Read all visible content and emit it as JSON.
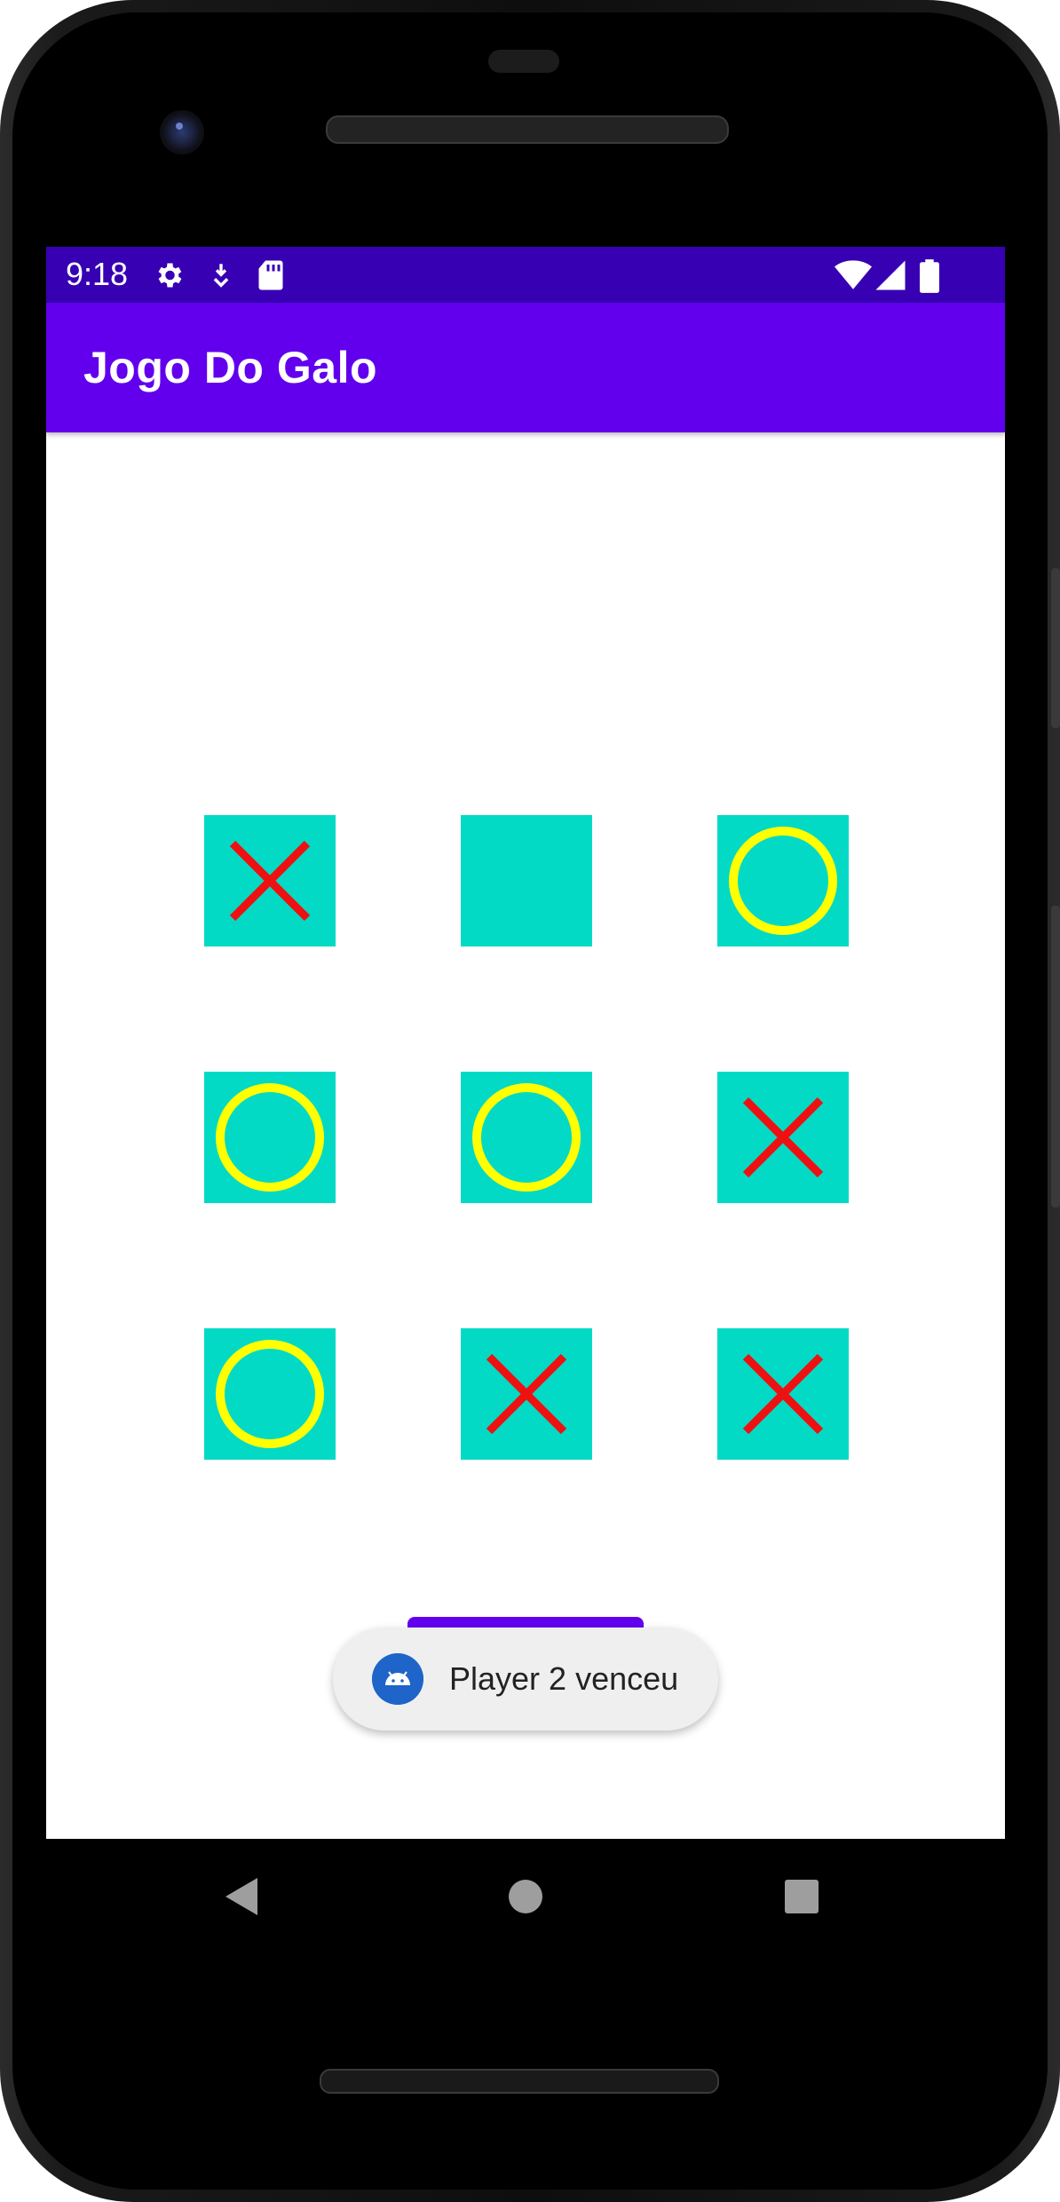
{
  "status_bar": {
    "time": "9:18",
    "left_icons": [
      "gear-icon",
      "download-icon",
      "sd-card-icon"
    ],
    "right_icons": [
      "wifi-icon",
      "signal-icon",
      "battery-icon"
    ],
    "background": "#3700b3"
  },
  "app_bar": {
    "title": "Jogo Do Galo",
    "background": "#6200ee"
  },
  "board": {
    "cell_color": "#03dac5",
    "x_color": "#ee1111",
    "o_color": "#ffff00",
    "cells": [
      "X",
      "",
      "O",
      "O",
      "O",
      "X",
      "O",
      "X",
      "X"
    ]
  },
  "toast": {
    "message": "Player 2 venceu",
    "icon": "android-icon"
  },
  "nav_bar": {
    "buttons": [
      "back-icon",
      "home-icon",
      "recents-icon"
    ]
  }
}
